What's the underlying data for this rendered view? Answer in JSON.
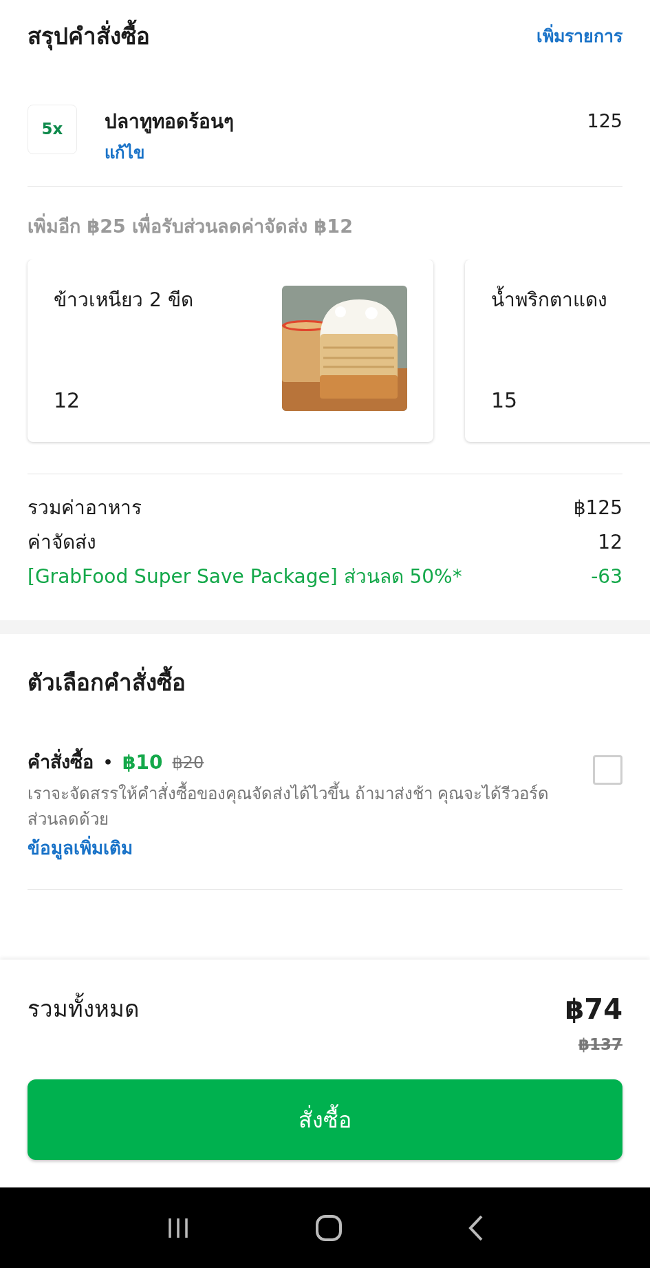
{
  "header": {
    "title": "สรุปคำสั่งซื้อ",
    "add_link": "เพิ่มรายการ"
  },
  "items": [
    {
      "quantity": "5x",
      "name": "ปลาทูทอดร้อนๆ",
      "edit": "แก้ไข",
      "price": "125"
    }
  ],
  "upsell": {
    "hint": "เพิ่มอีก ฿25 เพื่อรับส่วนลดค่าจัดส่ง ฿12",
    "products": [
      {
        "name": "ข้าวเหนียว 2 ขีด",
        "price": "12",
        "kind": "picture"
      },
      {
        "name": "น้ำพริกตาแดง",
        "price": "15",
        "kind": "plain"
      }
    ]
  },
  "summary": [
    {
      "label": "รวมค่าอาหาร",
      "value": "฿125",
      "kind": "normal"
    },
    {
      "label": "ค่าจัดส่ง",
      "value": "12",
      "kind": "normal"
    },
    {
      "label": "[GrabFood Super Save Package] ส่วนลด 50%*",
      "value": "-63",
      "kind": "discount"
    }
  ],
  "options": {
    "title": "ตัวเลือกคำสั่งซื้อ",
    "items": [
      {
        "title": "คำสั่งซื้อ",
        "separator": "•",
        "price": "฿10",
        "original_price": "฿20",
        "description": "เราจะจัดสรรให้คำสั่งซื้อของคุณจัดส่งได้ไวขึ้น ถ้ามาส่งช้า คุณจะได้รีวอร์ดส่วนลดด้วย",
        "link": "ข้อมูลเพิ่มเติม",
        "checked": false
      }
    ]
  },
  "footer": {
    "total_label": "รวมทั้งหมด",
    "total": "฿74",
    "original_total": "฿137",
    "order_button": "สั่งซื้อ"
  }
}
